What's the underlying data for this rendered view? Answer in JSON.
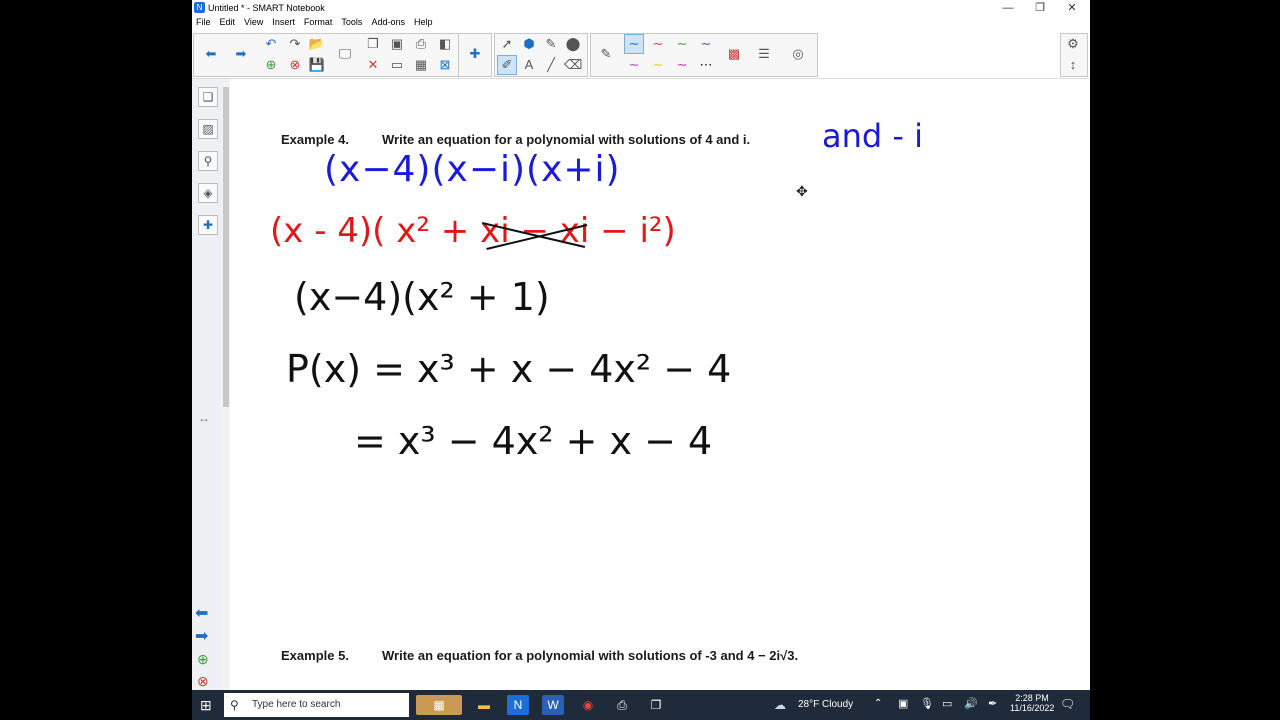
{
  "window": {
    "title": "Untitled * - SMART Notebook",
    "controls": {
      "minimize": "—",
      "restore": "❐",
      "close": "✕"
    }
  },
  "menu": [
    "File",
    "Edit",
    "View",
    "Insert",
    "Format",
    "Tools",
    "Add-ons",
    "Help"
  ],
  "colors": {
    "blue_ink": "#1a1ad8",
    "red_ink": "#e01818",
    "black_ink": "#111111",
    "accent": "#1f6fc0"
  },
  "page": {
    "example4": {
      "label": "Example 4.",
      "prompt": "Write an equation for a polynomial with solutions  of 4 and i."
    },
    "handwriting": {
      "and_i": "and  - i",
      "line_blue": "(x−4)(x−i)(x+i)",
      "line_red_a": "(x - 4)( x² + ",
      "line_red_strike": "xi − xi",
      "line_red_b": " − i²)",
      "line3": "(x−4)(x² + 1)",
      "line4": "P(x) = x³ + x − 4x² − 4",
      "line5": "= x³ − 4x² + x − 4"
    },
    "example5": {
      "label": "Example 5.",
      "prompt": "Write an equation for a polynomial with solutions of -3 and 4 − 2i√3."
    }
  },
  "taskbar": {
    "search_placeholder": "Type here to search",
    "weather": "28°F  Cloudy",
    "time": "2:28 PM",
    "date": "11/16/2022"
  }
}
